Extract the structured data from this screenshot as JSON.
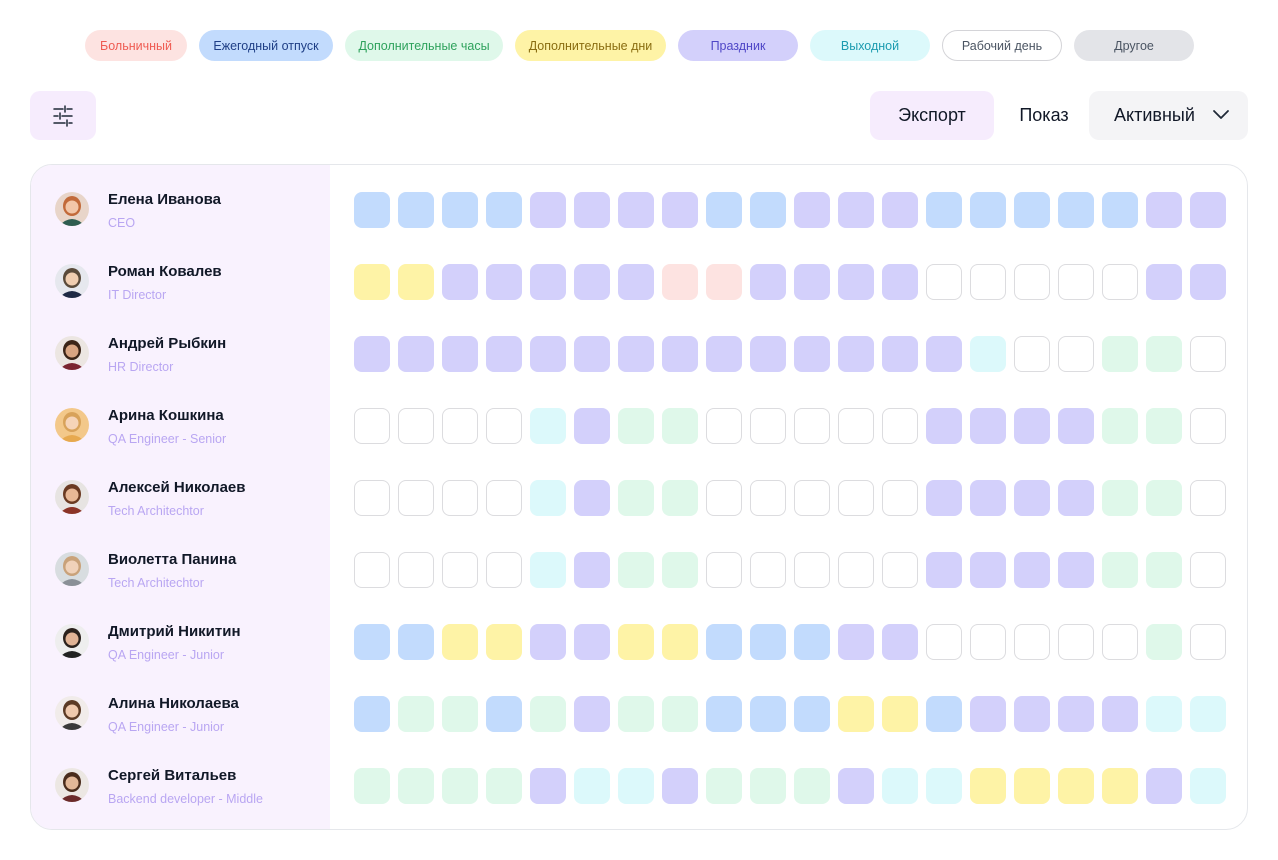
{
  "legend": [
    {
      "key": "s",
      "label": "Больничный",
      "color": "#fde3e1"
    },
    {
      "key": "a",
      "label": "Ежегодный отпуск",
      "color": "#c2dbfd"
    },
    {
      "key": "x",
      "label": "Дополнительные часы",
      "color": "#dff8ea"
    },
    {
      "key": "d",
      "label": "Дополнительные дни",
      "color": "#fef3a6"
    },
    {
      "key": "h",
      "label": "Праздник",
      "color": "#d3d0fb"
    },
    {
      "key": "o",
      "label": "Выходной",
      "color": "#dcf9fb"
    },
    {
      "key": "w",
      "label": "Рабочий день",
      "color": "#ffffff"
    },
    {
      "key": "n",
      "label": "Другое",
      "color": "#e3e4e8"
    }
  ],
  "toolbar": {
    "filter_icon": "sliders-icon",
    "export_label": "Экспорт",
    "show_label": "Показ",
    "status_value": "Активный"
  },
  "employees": [
    {
      "name": "Елена Иванова",
      "role": "CEO",
      "days": "aaaahhhhaahhhaaaaahh"
    },
    {
      "name": "Роман Ковалев",
      "role": "IT Director",
      "days": "ddhhhhhsshhhhwwwwwhh"
    },
    {
      "name": "Андрей Рыбкин",
      "role": "HR Director",
      "days": "hhhhhhhhhhhhhhowwxxw"
    },
    {
      "name": "Арина Кошкина",
      "role": "QA Engineer - Senior",
      "days": "wwwwohxxwwwwwhhhhxxw"
    },
    {
      "name": "Алексей Николаев",
      "role": "Tech Architechtor",
      "days": "wwwwohxxwwwwwhhhhxxw"
    },
    {
      "name": "Виолетта Панина",
      "role": "Tech Architechtor",
      "days": "wwwwohxxwwwwwhhhhxxw"
    },
    {
      "name": "Дмитрий Никитин",
      "role": "QA Engineer - Junior",
      "days": "aaddhhddaaahhwwwwwxw"
    },
    {
      "name": "Алина Николаева",
      "role": "QA Engineer - Junior",
      "days": "axxaxhxxaaaddahhhhoo"
    },
    {
      "name": "Сергей Витальев",
      "role": "Backend developer - Middle",
      "days": "xxxxhoohxxxhooddddho"
    }
  ]
}
